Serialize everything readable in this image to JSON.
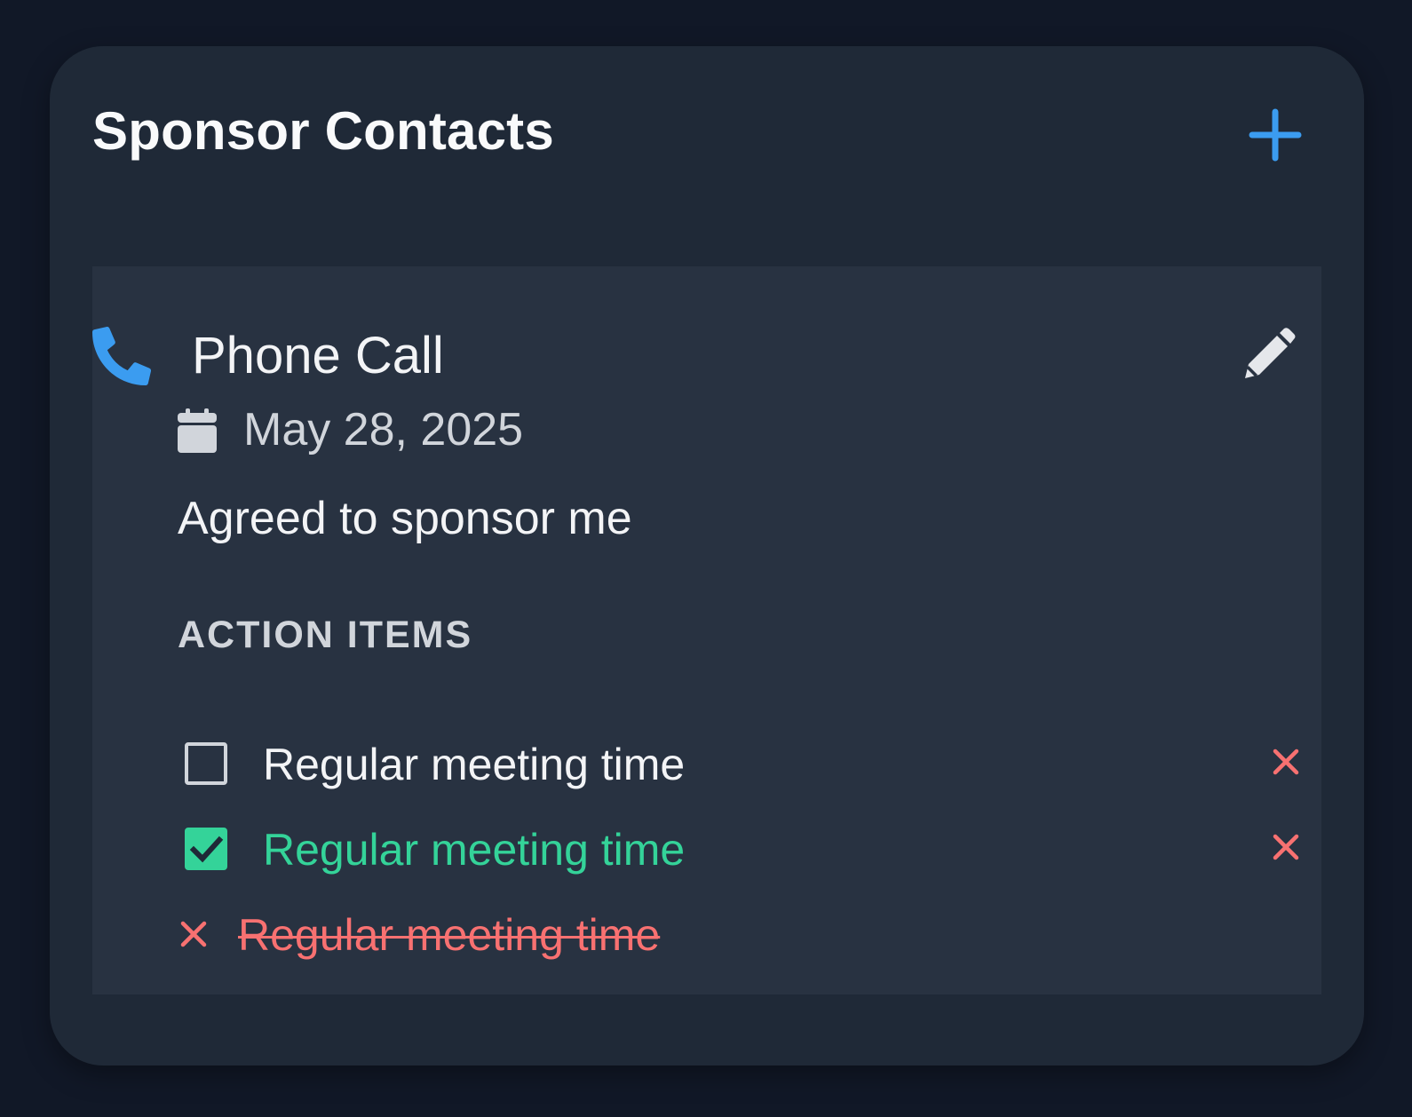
{
  "card": {
    "title": "Sponsor Contacts",
    "add_icon": "plus-icon"
  },
  "entry": {
    "type_icon": "phone-icon",
    "type": "Phone Call",
    "edit_icon": "pencil-icon",
    "date_icon": "calendar-icon",
    "date": "May 28, 2025",
    "note": "Agreed to sponsor me",
    "action_items_label": "ACTION ITEMS",
    "action_items": [
      {
        "text": "Regular meeting time",
        "status": "open"
      },
      {
        "text": "Regular meeting time",
        "status": "done"
      },
      {
        "text": "Regular meeting time",
        "status": "cancelled"
      }
    ]
  },
  "colors": {
    "background": "#111827",
    "card": "#1f2937",
    "entry": "#283241",
    "accent_blue": "#3b9cf0",
    "done_green": "#34d399",
    "remove_red": "#f87171"
  }
}
